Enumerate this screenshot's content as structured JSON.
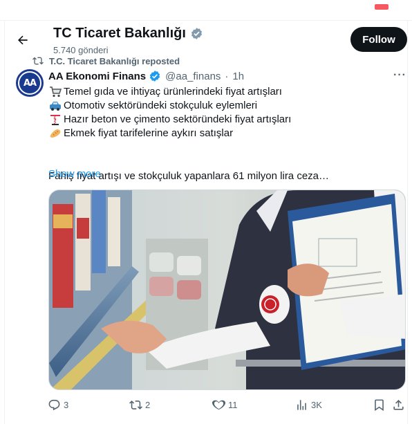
{
  "header": {
    "title": "TC Ticaret Bakanlığı",
    "posts_count": "5.740 gönderi",
    "follow_label": "Follow"
  },
  "repost": {
    "text": "T.C. Ticaret Bakanlığı reposted"
  },
  "tweet": {
    "author_name": "AA Ekonomi Finans",
    "author_handle": "@aa_finans",
    "separator": "·",
    "time": "1h",
    "avatar_text": "AA",
    "lines": [
      {
        "icon": "shopping-cart-icon",
        "text": "Temel gıda ve ihtiyaç ürünlerindeki fiyat artışları"
      },
      {
        "icon": "car-icon",
        "text": "Otomotiv sektöründeki stokçuluk eylemleri"
      },
      {
        "icon": "construction-crane-icon",
        "text": "Hazır beton ve çimento sektöründeki fiyat artışları"
      },
      {
        "icon": "bread-icon",
        "text": "Ekmek fiyat tarifelerine aykırı satışlar"
      }
    ],
    "summary": "Fahiş fiyat artışı ve stokçuluk yapanlara 61 milyon lira ceza…",
    "show_more": "Show more"
  },
  "actions": {
    "replies": "3",
    "reposts": "2",
    "likes": "11",
    "views": "3K"
  },
  "colors": {
    "accent": "#1d9bf0",
    "text": "#0f1419",
    "muted": "#536471",
    "verified": "#829aab"
  }
}
